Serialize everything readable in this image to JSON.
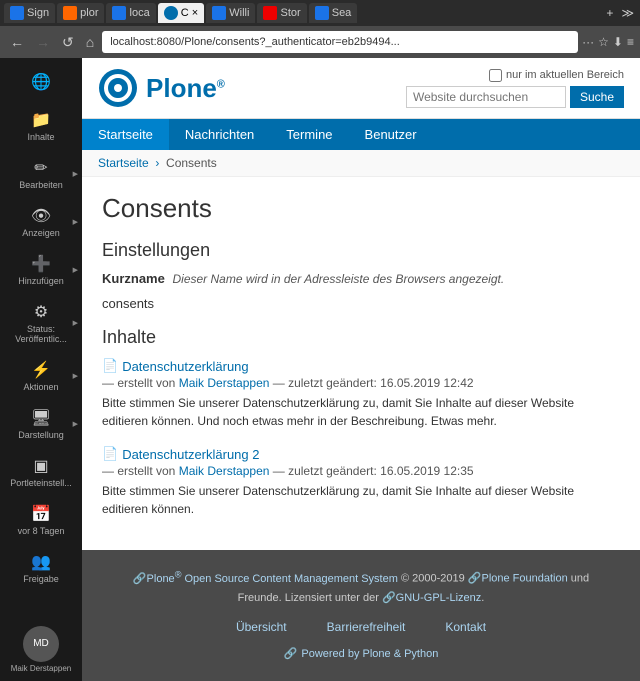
{
  "browser": {
    "tabs": [
      {
        "id": "t1",
        "label": "Sign",
        "active": false,
        "favicon": "blue"
      },
      {
        "id": "t2",
        "label": "plor",
        "active": false,
        "favicon": "orange"
      },
      {
        "id": "t3",
        "label": "loca",
        "active": false,
        "favicon": "blue"
      },
      {
        "id": "t4",
        "label": "C ×",
        "active": true,
        "favicon": "plone"
      },
      {
        "id": "t5",
        "label": "Willi",
        "active": false,
        "favicon": "blue"
      },
      {
        "id": "t6",
        "label": "Stor",
        "active": false,
        "favicon": "red"
      },
      {
        "id": "t7",
        "label": "Sea",
        "active": false,
        "favicon": "blue"
      }
    ],
    "url": "localhost:8080/Plone/consents?_authenticator=eb2b9494...",
    "extra_buttons": [
      "···",
      "☆",
      "⬇",
      "≡"
    ]
  },
  "sidebar": {
    "items": [
      {
        "id": "globe",
        "icon": "🌐",
        "label": ""
      },
      {
        "id": "inhalte",
        "icon": "📁",
        "label": "Inhalte"
      },
      {
        "id": "bearbeiten",
        "icon": "✏",
        "label": "Bearbeiten",
        "arrow": true
      },
      {
        "id": "anzeigen",
        "icon": "👁",
        "label": "Anzeigen",
        "arrow": true
      },
      {
        "id": "hinzufuegen",
        "icon": "➕",
        "label": "Hinzufügen",
        "arrow": true
      },
      {
        "id": "status",
        "icon": "⚙",
        "label": "Status: Veröffentlic...",
        "arrow": true
      },
      {
        "id": "aktionen",
        "icon": "⚡",
        "label": "Aktionen",
        "arrow": true
      },
      {
        "id": "darstellung",
        "icon": "🖥",
        "label": "Darstellung",
        "arrow": true
      },
      {
        "id": "portleteinst",
        "icon": "▣",
        "label": "Portleteinstell..."
      },
      {
        "id": "vor8tagen",
        "icon": "📅",
        "label": "vor 8 Tagen"
      },
      {
        "id": "freigabe",
        "icon": "👥",
        "label": "Freigabe"
      }
    ],
    "user": {
      "name": "Maik Derstappen",
      "initials": "MD"
    }
  },
  "header": {
    "logo_text": "Plone",
    "logo_reg": "®",
    "search_checkbox_label": "nur im aktuellen Bereich",
    "search_placeholder": "Website durchsuchen",
    "search_button": "Suche"
  },
  "nav": {
    "items": [
      {
        "id": "startseite",
        "label": "Startseite",
        "active": true
      },
      {
        "id": "nachrichten",
        "label": "Nachrichten",
        "active": false
      },
      {
        "id": "termine",
        "label": "Termine",
        "active": false
      },
      {
        "id": "benutzer",
        "label": "Benutzer",
        "active": false
      }
    ]
  },
  "breadcrumb": {
    "items": [
      {
        "label": "Startseite",
        "link": true
      },
      {
        "label": "Consents",
        "link": false
      }
    ]
  },
  "page": {
    "title": "Consents",
    "settings_title": "Einstellungen",
    "field_label": "Kurzname",
    "field_hint": "Dieser Name wird in der Adressleiste des Browsers angezeigt.",
    "field_value": "consents",
    "inhalte_title": "Inhalte",
    "items": [
      {
        "id": "item1",
        "title": "Datenschutzerklärung",
        "meta": "— erstellt von Maik Derstappen — zuletzt geändert: 16.05.2019 12:42",
        "desc": "Bitte stimmen Sie unserer Datenschutzerklärung zu, damit Sie Inhalte auf dieser Website editieren können. Und noch etwas mehr in der Beschreibung. Etwas mehr."
      },
      {
        "id": "item2",
        "title": "Datenschutzerklärung 2",
        "meta": "— erstellt von Maik Derstappen — zuletzt geändert: 16.05.2019 12:35",
        "desc": "Bitte stimmen Sie unserer Datenschutzerklärung zu, damit Sie Inhalte auf dieser Website editieren können."
      }
    ]
  },
  "footer": {
    "line1": "Plone® Open Source Content Management System © 2000-2019 Plone Foundation und",
    "line2": "Freunde. Lizensiert unter der GNU-GPL-Lizenz.",
    "links": [
      {
        "label": "Übersicht"
      },
      {
        "label": "Barrierefreiheit"
      },
      {
        "label": "Kontakt"
      }
    ],
    "powered": "Powered by Plone & Python"
  }
}
